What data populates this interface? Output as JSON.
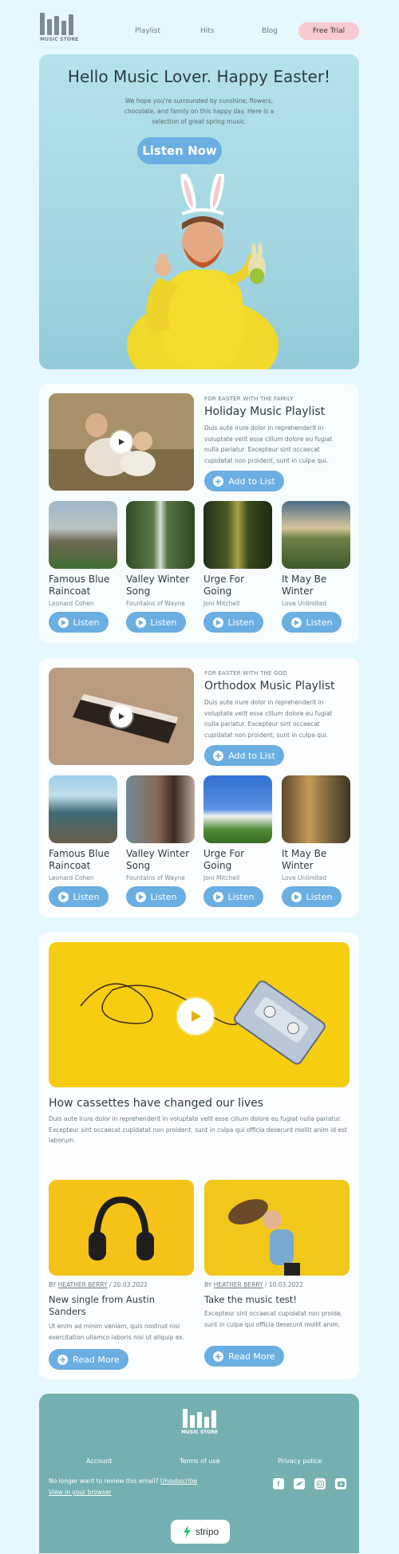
{
  "header": {
    "logo_text": "MUSIC STORE",
    "nav": [
      "Playlist",
      "Hits",
      "Blog"
    ],
    "trial_label": "Free Trial"
  },
  "hero": {
    "title": "Hello Music Lover. Happy Easter!",
    "subtitle": "We hope you're surrounded by sunshine, flowers, chocolate, and family on this happy day. Here is a selection of great spring music.",
    "cta": "Listen Now"
  },
  "playlists": [
    {
      "kicker": "FOR EASTER WITH THE FAMILY",
      "title": "Holiday Music Playlist",
      "text": "Duis aute irure dolor in reprehenderit in voluptate velit esse cillum dolore eu fugiat nulla pariatur. Excepteur sint occaecat cupidatat non proident, sunt in culpa qui.",
      "add_label": "Add to List",
      "songs": [
        {
          "title": "Famous Blue Raincoat",
          "artist": "Leonard Cohen",
          "button": "Listen"
        },
        {
          "title": "Valley Winter Song",
          "artist": "Fountains of Wayne",
          "button": "Listen"
        },
        {
          "title": "Urge For Going",
          "artist": "Joni Mitchell",
          "button": "Listen"
        },
        {
          "title": "It May Be Winter",
          "artist": "Love Unlimited",
          "button": "Listen"
        }
      ]
    },
    {
      "kicker": "FOR EASTER WITH THE GOD",
      "title": "Orthodox Music Playlist",
      "text": "Duis aute irure dolor in reprehenderit in voluptate velit esse cillum dolore eu fugiat nulla pariatur. Excepteur sint occaecat cupidatat non proident, sunt in culpa qui.",
      "add_label": "Add to List",
      "songs": [
        {
          "title": "Famous Blue Raincoat",
          "artist": "Leonard Cohen",
          "button": "Listen"
        },
        {
          "title": "Valley Winter Song",
          "artist": "Fountains of Wayne",
          "button": "Listen"
        },
        {
          "title": "Urge For Going",
          "artist": "Joni Mitchell",
          "button": "Listen"
        },
        {
          "title": "It May Be Winter",
          "artist": "Love Unlimited",
          "button": "Listen"
        }
      ]
    }
  ],
  "blog": {
    "title": "How cassettes have changed our lives",
    "text": "Duis aute irure dolor in reprehenderit in voluptate velit esse cillum dolore eu fugiat nulla pariatur. Excepteur sint occaecat cupidatat non proident, sunt in culpa qui officia deserunt mollit anim id est laborum.",
    "articles": [
      {
        "by": "BY",
        "author": "HEATHER BERRY",
        "date": "/ 20.03.2022",
        "title": "New single from Austin Sanders",
        "text": "Ut enim ad minim veniam, quis nostrud nisi exercitation ullamco laboris nisi ut aliquip ex.",
        "button": "Read More"
      },
      {
        "by": "BY",
        "author": "HEATHER BERRY",
        "date": "/ 10.03.2022",
        "title": "Take the music test!",
        "text": "Excepteur sint occaecat cupidatat non proide, sunt in culpa qui officia deserunt mollit anim.",
        "button": "Read More"
      }
    ]
  },
  "footer": {
    "logo_text": "MUSIC STORE",
    "links": [
      "Account",
      "Terms of use",
      "Privacy police"
    ],
    "unsubscribe_prefix": "No longer want to review this email?",
    "unsubscribe_link": "Unsubscribe",
    "view_browser": "View in your browser",
    "social_icons": [
      "facebook-icon",
      "twitter-icon",
      "instagram-icon",
      "youtube-icon"
    ],
    "badge": "stripo"
  },
  "colors": {
    "accent": "#6aaee2",
    "trial": "#f8c9cf",
    "footer": "#75b0b0",
    "page": "#e6f8ff"
  }
}
